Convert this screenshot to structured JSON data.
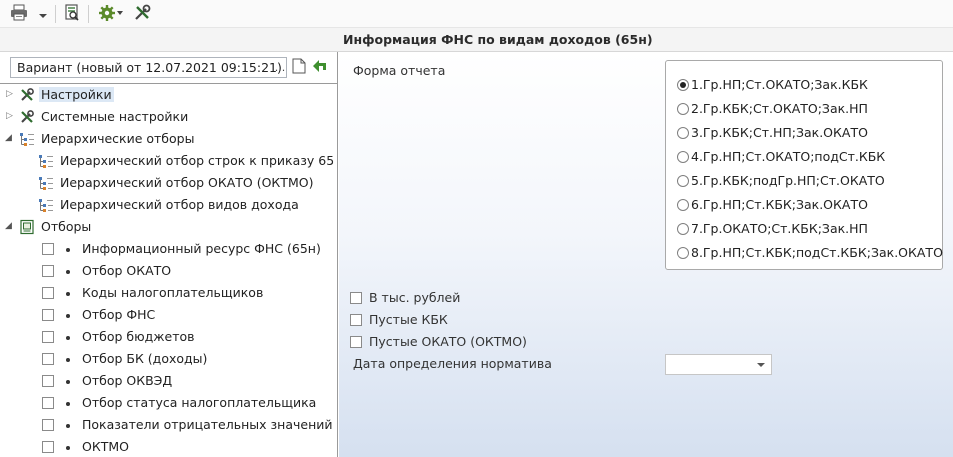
{
  "toolbar": {
    "icons": [
      "print-icon",
      "dropdown-arrow-icon",
      "preview-icon",
      "gear-icon",
      "tools-icon"
    ]
  },
  "window": {
    "title": "Информация ФНС по видам доходов (65н)"
  },
  "variant": {
    "value": "Вариант (новый от 12.07.2021 09:15:21)",
    "more_label": "..."
  },
  "tree": {
    "items": [
      {
        "label": "Настройки",
        "icon": "tools-icon",
        "selected": true
      },
      {
        "label": "Системные настройки",
        "icon": "tools-icon"
      },
      {
        "label": "Иерархические отборы",
        "icon": "hierarchy-icon"
      },
      {
        "label": "Иерархический отбор строк к приказу 65",
        "icon": "hierarchy-icon"
      },
      {
        "label": "Иерархический отбор ОКАТО (ОКТМО)",
        "icon": "hierarchy-icon"
      },
      {
        "label": "Иерархический отбор видов дохода",
        "icon": "hierarchy-icon"
      },
      {
        "label": "Отборы",
        "icon": "filter-icon"
      }
    ],
    "filters": [
      "Информационный ресурс ФНС (65н)",
      "Отбор ОКАТО",
      "Коды налогоплательщиков",
      "Отбор ФНС",
      "Отбор бюджетов",
      "Отбор БК (доходы)",
      "Отбор ОКВЭД",
      "Отбор статуса налогоплательщика",
      "Показатели отрицательных значений",
      "ОКТМО"
    ]
  },
  "report": {
    "form_label": "Форма отчета",
    "forms": [
      "1.Гр.НП;Ст.ОКАТО;Зак.КБК",
      "2.Гр.КБК;Ст.ОКАТО;Зак.НП",
      "3.Гр.КБК;Ст.НП;Зак.ОКАТО",
      "4.Гр.НП;Ст.ОКАТО;подСт.КБК",
      "5.Гр.КБК;подГр.НП;Ст.ОКАТО",
      "6.Гр.НП;Ст.КБК;Зак.ОКАТО",
      "7.Гр.ОКАТО;Ст.КБК;Зак.НП",
      "8.Гр.НП;Ст.КБК;подСт.КБК;Зак.ОКАТО"
    ],
    "selected_form_index": 0,
    "options": [
      {
        "label": "В тыс. рублей",
        "checked": false
      },
      {
        "label": "Пустые КБК",
        "checked": false
      },
      {
        "label": "Пустые ОКАТО (ОКТМО)",
        "checked": false
      }
    ],
    "date_label": "Дата определения норматива",
    "date_value": ""
  }
}
